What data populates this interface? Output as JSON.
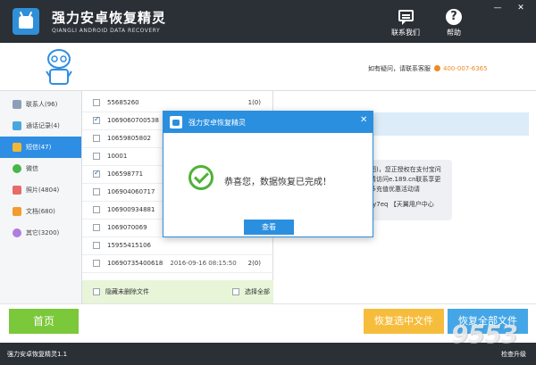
{
  "app": {
    "title": "强力安卓恢复精灵",
    "subtitle": "QIANGLI ANDROID DATA RECOVERY"
  },
  "top_actions": {
    "contact_label": "联系我们",
    "help_label": "帮助",
    "help_glyph": "?"
  },
  "window_controls": {
    "minimize": "—",
    "close": "✕"
  },
  "banner": {
    "hotline_text": "如有疑问，请联系客服",
    "hotline_number": "400-007-6365"
  },
  "sidebar": {
    "items": [
      {
        "label": "联系人(96)",
        "icon": "contacts-icon"
      },
      {
        "label": "通话记录(4)",
        "icon": "call-log-icon"
      },
      {
        "label": "短信(47)",
        "icon": "sms-icon",
        "active": true
      },
      {
        "label": "微信",
        "icon": "wechat-icon"
      },
      {
        "label": "照片(4804)",
        "icon": "photos-icon"
      },
      {
        "label": "文档(680)",
        "icon": "documents-icon"
      },
      {
        "label": "其它(3200)",
        "icon": "other-icon"
      }
    ]
  },
  "list": {
    "rows": [
      {
        "number": "55685260",
        "checked": false,
        "time": "",
        "count": "1(0)"
      },
      {
        "number": "1069060700538",
        "checked": true,
        "time": "",
        "count": ""
      },
      {
        "number": "10659805802",
        "checked": false,
        "time": "",
        "count": ""
      },
      {
        "number": "10001",
        "checked": false,
        "time": "",
        "count": ""
      },
      {
        "number": "106598771",
        "checked": true,
        "time": "",
        "count": ""
      },
      {
        "number": "106904060717",
        "checked": false,
        "time": "",
        "count": ""
      },
      {
        "number": "106900934881",
        "checked": false,
        "time": "",
        "count": ""
      },
      {
        "number": "1069070069",
        "checked": false,
        "time": "",
        "count": ""
      },
      {
        "number": "15955415106",
        "checked": false,
        "time": "",
        "count": ""
      },
      {
        "number": "10690735400618",
        "checked": false,
        "time": "2016-09-16 08:15:50",
        "count": "2(0)"
      }
    ],
    "hide_deleted_label": "隐藏未删除文件",
    "select_all_label": "选择全部"
  },
  "detail": {
    "bubble_text": "图)，您正授权在支付宝问请访问e.189.cn联系享更多充值优惠活动请",
    "bubble2_text": "Vfy7eq 【天翼用户中心"
  },
  "bottom": {
    "home_label": "首页",
    "recover_selected_label": "恢复选中文件",
    "recover_all_label": "恢复全部文件"
  },
  "status": {
    "version": "强力安卓恢复精灵1.1",
    "check_update": "检查升级",
    "watermark": "9553"
  },
  "dialog": {
    "title": "强力安卓恢复精灵",
    "close": "✕",
    "message": "恭喜您，数据恢复已完成！",
    "button_label": "查看"
  },
  "colors": {
    "titlebar": "#2b2f36",
    "accent_blue": "#2b8fdf",
    "home_green": "#7bc83b",
    "recover_selected_orange": "#f6bd3c",
    "recover_all_blue": "#44a6e6",
    "success_green": "#4fb236",
    "hotline_orange": "#f08a24"
  }
}
